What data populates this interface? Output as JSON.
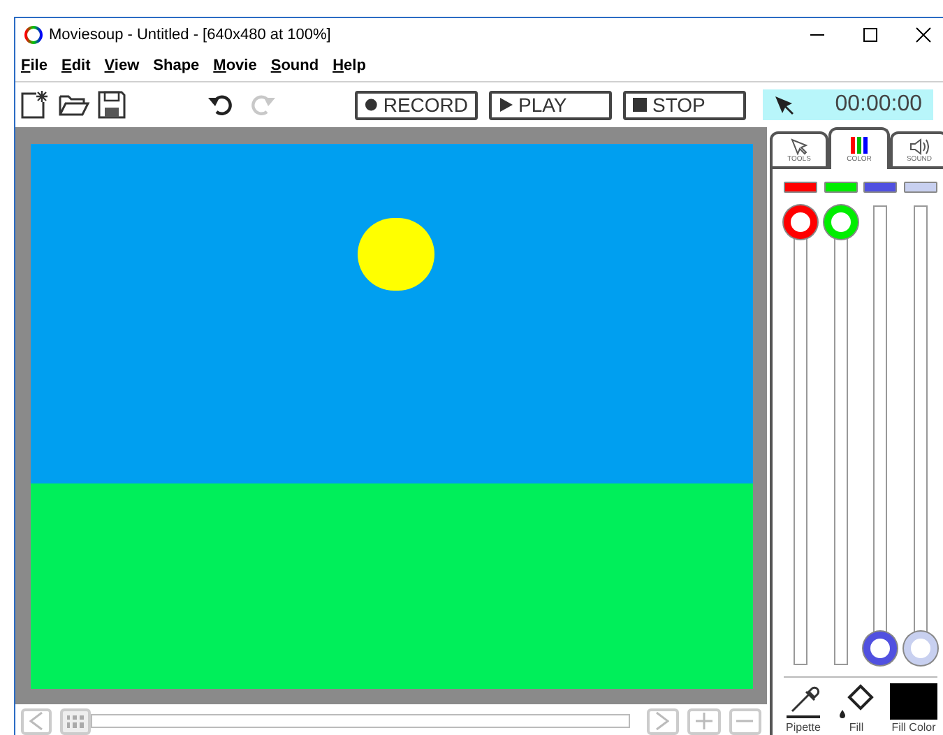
{
  "window": {
    "title": "Moviesoup - Untitled - [640x480 at 100%]"
  },
  "menu": [
    {
      "label": "File",
      "underline_first": true
    },
    {
      "label": "Edit",
      "underline_first": true
    },
    {
      "label": "View",
      "underline_first": true
    },
    {
      "label": "Shape",
      "underline_first": false
    },
    {
      "label": "Movie",
      "underline_first": true
    },
    {
      "label": "Sound",
      "underline_first": true
    },
    {
      "label": "Help",
      "underline_first": true
    }
  ],
  "toolbar": {
    "redo_disabled": true,
    "transport": [
      {
        "kind": "record",
        "label": "RECORD"
      },
      {
        "kind": "play",
        "label": "PLAY"
      },
      {
        "kind": "stop",
        "label": "STOP"
      }
    ],
    "time": "00:00:00"
  },
  "panel": {
    "tabs": [
      {
        "kind": "tools",
        "label": "TOOLS",
        "selected": false
      },
      {
        "kind": "color",
        "label": "COLOR",
        "selected": true
      },
      {
        "kind": "sound",
        "label": "SOUND",
        "selected": false
      }
    ],
    "sliders": [
      {
        "color": "#ff0000",
        "level": 1
      },
      {
        "color": "#00ee00",
        "level": 1
      },
      {
        "color": "#5050e0",
        "level": 0
      },
      {
        "color": "#c8d0f0",
        "level": 0
      }
    ],
    "tools": [
      {
        "kind": "pipette",
        "label": "Pipette"
      },
      {
        "kind": "fill",
        "label": "Fill"
      },
      {
        "kind": "fill_color",
        "label": "Fill Color"
      }
    ]
  }
}
